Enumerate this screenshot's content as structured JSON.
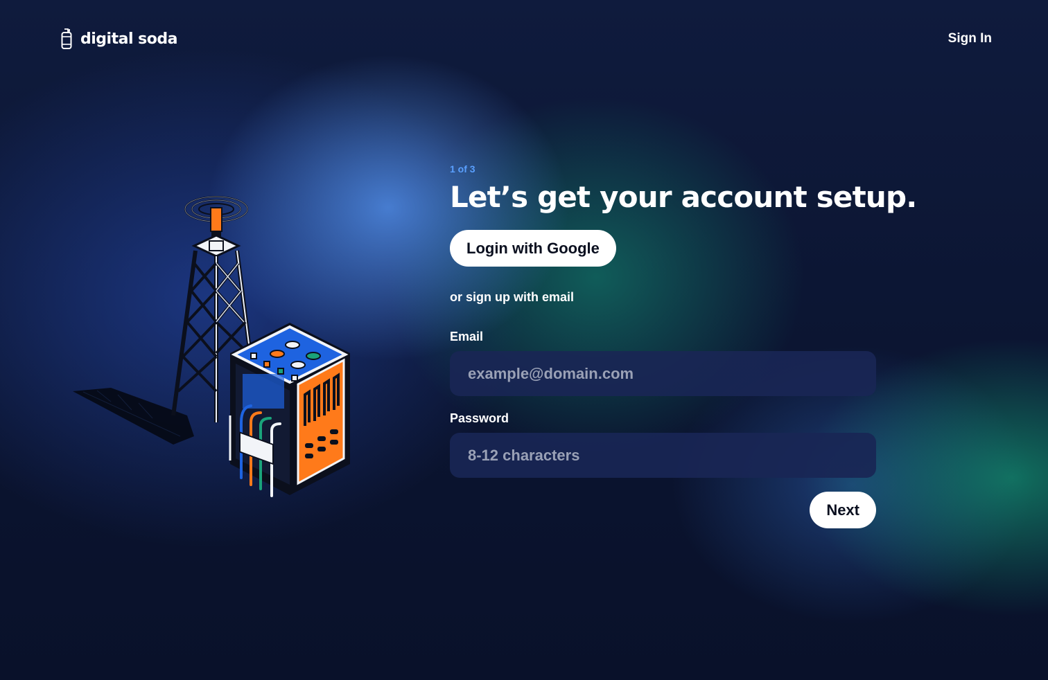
{
  "brand": {
    "name": "digital soda",
    "icon": "soda-bottle-icon"
  },
  "nav": {
    "sign_in": "Sign In"
  },
  "illustration": {
    "name": "radio-tower-and-server-illustration"
  },
  "form": {
    "step": "1 of 3",
    "title": "Let’s get your account setup.",
    "google_button": "Login with Google",
    "divider_text": "or sign up with email",
    "email_label": "Email",
    "email_placeholder": "example@domain.com",
    "email_value": "",
    "password_label": "Password",
    "password_placeholder": "8-12 characters",
    "password_value": "",
    "next_button": "Next"
  },
  "colors": {
    "background": "#0d1733",
    "accent_blue": "#4a86e8",
    "accent_green": "#14a078",
    "step_text": "#5aa0ff",
    "input_bg": "#192655",
    "button_bg": "#ffffff",
    "illustration_orange": "#ff7a1a",
    "illustration_blue": "#1e63e0"
  }
}
